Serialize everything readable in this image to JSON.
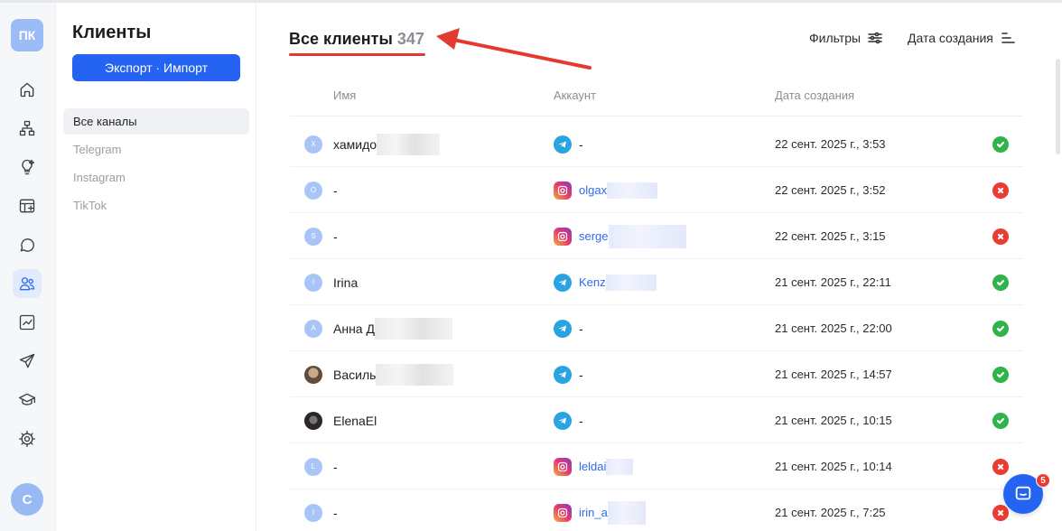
{
  "app": {
    "logo_text": "ПК",
    "user_initial": "С"
  },
  "rail": {
    "items": [
      {
        "icon": "home-icon"
      },
      {
        "icon": "structure-icon"
      },
      {
        "icon": "lightbulb-icon"
      },
      {
        "icon": "board-icon"
      },
      {
        "icon": "chat-icon"
      },
      {
        "icon": "users-icon",
        "active": true
      },
      {
        "icon": "analytics-icon"
      },
      {
        "icon": "send-icon"
      },
      {
        "icon": "education-icon"
      },
      {
        "icon": "settings-icon"
      }
    ]
  },
  "sidebar": {
    "title": "Клиенты",
    "export_label": "Экспорт · Импорт",
    "channels": [
      "Все каналы",
      "Telegram",
      "Instagram",
      "TikTok"
    ],
    "active_channel": "Все каналы"
  },
  "main": {
    "title": "Все клиенты",
    "count": "347",
    "filters_label": "Фильтры",
    "sort_label": "Дата создания",
    "columns": {
      "name": "Имя",
      "account": "Аккаунт",
      "created": "Дата создания"
    }
  },
  "rows": [
    {
      "avatar": "Х",
      "name": "хамидо",
      "network": "telegram",
      "account": "-",
      "created": "22 сент. 2025 г., 3:53",
      "status": "ok"
    },
    {
      "avatar": "O",
      "name": "-",
      "network": "instagram",
      "account": "olgax",
      "created": "22 сент. 2025 г., 3:52",
      "status": "bad"
    },
    {
      "avatar": "S",
      "name": "-",
      "network": "instagram",
      "account": "serge",
      "created": "22 сент. 2025 г., 3:15",
      "status": "bad"
    },
    {
      "avatar": "I",
      "name": "Irina",
      "network": "telegram",
      "account": "Kenz",
      "created": "21 сент. 2025 г., 22:11",
      "status": "ok"
    },
    {
      "avatar": "А",
      "name": "Анна Д",
      "network": "telegram",
      "account": "-",
      "created": "21 сент. 2025 г., 22:00",
      "status": "ok"
    },
    {
      "avatar": "",
      "name": "Василь",
      "network": "telegram",
      "account": "-",
      "created": "21 сент. 2025 г., 14:57",
      "status": "ok"
    },
    {
      "avatar": "",
      "name": "ElenaEl",
      "network": "telegram",
      "account": "-",
      "created": "21 сент. 2025 г., 10:15",
      "status": "ok"
    },
    {
      "avatar": "L",
      "name": "-",
      "network": "instagram",
      "account": "leldai",
      "created": "21 сент. 2025 г., 10:14",
      "status": "bad"
    },
    {
      "avatar": "I",
      "name": "-",
      "network": "instagram",
      "account": "irin_a",
      "created": "21 сент. 2025 г., 7:25",
      "status": "bad"
    }
  ],
  "chat": {
    "badge": "5"
  },
  "colors": {
    "accent": "#2564f3",
    "ok": "#2fb34a",
    "bad": "#ec3b33",
    "annotation": "#e33a2f"
  }
}
